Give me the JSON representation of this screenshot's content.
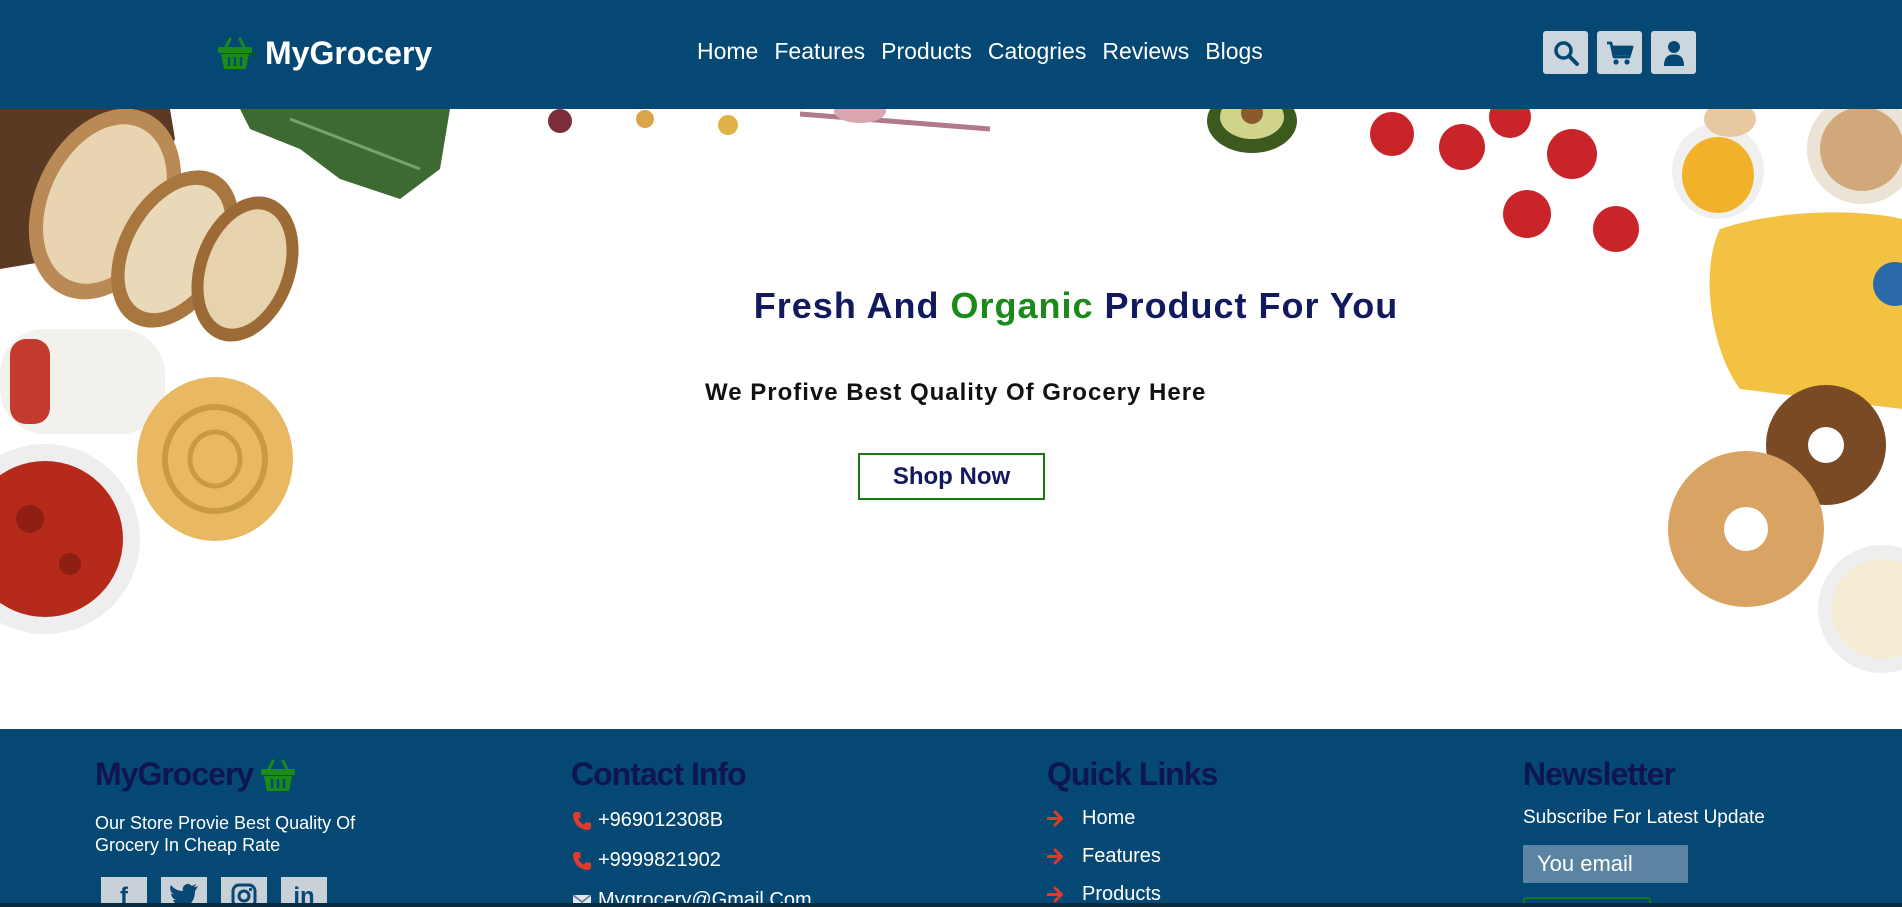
{
  "colors": {
    "navbar_bg": "#054874",
    "accent_green": "#1a8a1a",
    "heading_navy": "#12195f",
    "icon_button_bg": "#ccd6de"
  },
  "header": {
    "logo_text": "MyGrocery",
    "logo_icon": "basket-icon",
    "nav": [
      "Home",
      "Features",
      "Products",
      "Catogries",
      "Reviews",
      "Blogs"
    ],
    "icons": [
      "search-icon",
      "cart-icon",
      "user-icon"
    ]
  },
  "hero": {
    "title_part1": "Fresh And",
    "title_accent": "Organic",
    "title_part2": "Product For You",
    "subtitle": "We Profive Best Quality Of Grocery Here",
    "cta_label": "Shop Now"
  },
  "footer": {
    "brand": {
      "heading": "MyGrocery",
      "description": "Our Store Provie Best Quality Of Grocery In Cheap Rate",
      "socials": [
        {
          "icon": "facebook-icon",
          "glyph": "f"
        },
        {
          "icon": "twitter-icon",
          "glyph": "t"
        },
        {
          "icon": "instagram-icon",
          "glyph": "o"
        },
        {
          "icon": "linkedin-icon",
          "glyph": "in"
        }
      ]
    },
    "contact": {
      "heading": "Contact Info",
      "phone1": "+969012308B",
      "phone2": "+9999821902",
      "email": "Mygrocery@Gmail.Com"
    },
    "quick_links": {
      "heading": "Quick Links",
      "items": [
        "Home",
        "Features",
        "Products"
      ]
    },
    "newsletter": {
      "heading": "Newsletter",
      "text": "Subscribe For Latest Update",
      "email_placeholder": "You email"
    }
  }
}
